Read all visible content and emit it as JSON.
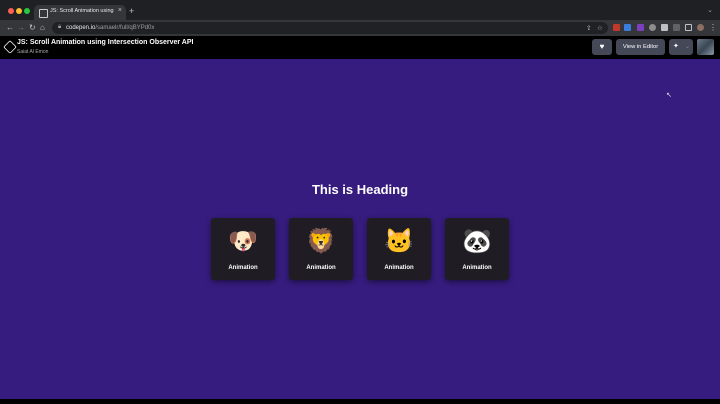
{
  "browser": {
    "tab_title": "JS: Scroll Animation using Inte...",
    "tab_close": "×",
    "new_tab": "+",
    "url_domain": "codepen.io",
    "url_path": "/samaelr/full/qBYPd0x"
  },
  "header": {
    "pen_title": "JS: Scroll Animation using Intersection Observer API",
    "author": "Saiat Al Emon",
    "heart": "♥",
    "view_in_editor": "View in Editor",
    "pin": "📌",
    "chevron": "⌄"
  },
  "main": {
    "heading": "This is Heading",
    "cards": [
      {
        "emoji": "🐶",
        "label": "Animation"
      },
      {
        "emoji": "🦁",
        "label": "Animation"
      },
      {
        "emoji": "🐱",
        "label": "Animation"
      },
      {
        "emoji": "🐼",
        "label": "Animation"
      }
    ]
  },
  "colors": {
    "page_bg": "#361c7e",
    "card_bg": "#1f1c24",
    "header_bg": "#000000",
    "button_bg": "#444857"
  },
  "icons": [
    "close-icon",
    "plus-icon",
    "back-icon",
    "forward-icon",
    "reload-icon",
    "home-icon",
    "lock-icon",
    "share-icon",
    "star-icon",
    "codepen-logo",
    "heart-icon",
    "pin-icon",
    "chevron-down-icon",
    "cursor-icon"
  ]
}
